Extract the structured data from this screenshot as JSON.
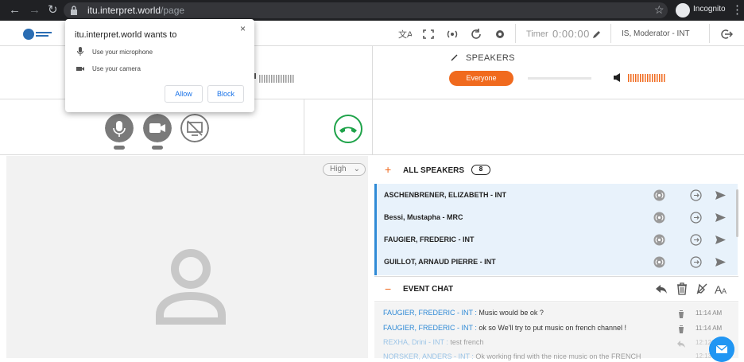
{
  "browser": {
    "url_host": "itu.interpret.world",
    "url_path": "/page",
    "incognito_label": "Incognito",
    "back_glyph": "←",
    "forward_glyph": "→",
    "reload_glyph": "↻",
    "star_glyph": "☆",
    "menu_glyph": "⋮"
  },
  "topbar": {
    "timer_label": "Timer",
    "timer_value": "0:00:00",
    "user_label": "IS, Moderator - INT"
  },
  "speakers_panel": {
    "title": "SPEAKERS",
    "everyone_button": "Everyone"
  },
  "stage": {
    "quality_value": "High"
  },
  "all_speakers": {
    "title": "ALL SPEAKERS",
    "count": "8",
    "items": [
      {
        "name": "ASCHENBRENER, ELIZABETH - INT"
      },
      {
        "name": "Bessi, Mustapha - MRC"
      },
      {
        "name": "FAUGIER, FREDERIC - INT"
      },
      {
        "name": "GUILLOT, ARNAUD PIERRE - INT"
      }
    ]
  },
  "event_chat": {
    "title": "EVENT CHAT",
    "messages": [
      {
        "sender": "FAUGIER, FREDERIC - INT :",
        "text": " Music would be ok ?",
        "time": "11:14 AM"
      },
      {
        "sender": "FAUGIER, FREDERIC - INT :",
        "text": " ok so We'll try to put music on french channel !",
        "time": "11:14 AM"
      },
      {
        "sender": "REXHA, Drini - INT :",
        "text": " test french",
        "time": "12:12"
      },
      {
        "sender": "NORSKER, ANDERS - INT :",
        "text": " Ok working find with the nice music on the FRENCH",
        "time": "12:13"
      }
    ]
  },
  "permission_popup": {
    "title": "itu.interpret.world wants to",
    "microphone": "Use your microphone",
    "camera": "Use your camera",
    "allow": "Allow",
    "block": "Block",
    "close_glyph": "×"
  },
  "colors": {
    "accent": "#f06a1e",
    "link": "#2f8ad6",
    "hangup": "#1fa34a",
    "fab": "#2196f3"
  },
  "icons": [
    "translate-icon",
    "fullscreen-icon",
    "broadcast-icon",
    "refresh-icon",
    "gear-icon",
    "edit-icon",
    "logout-icon",
    "microphone-icon",
    "camera-icon",
    "screen-share-off-icon",
    "hangup-phone-icon",
    "speaker-icon",
    "mail-icon",
    "trash-icon",
    "reply-icon",
    "mute-icon",
    "font-size-icon"
  ]
}
